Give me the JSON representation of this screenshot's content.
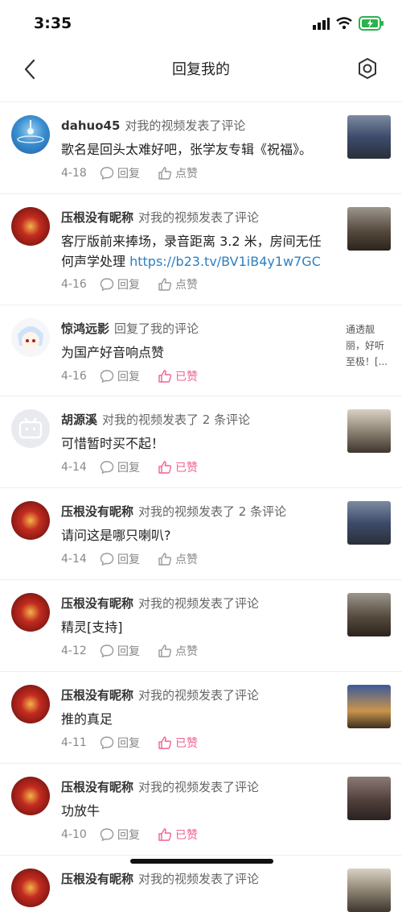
{
  "status": {
    "time": "3:35"
  },
  "nav": {
    "title": "回复我的"
  },
  "labels": {
    "reply": "回复",
    "like": "点赞",
    "liked": "已赞"
  },
  "items": [
    {
      "user": "dahuo45",
      "action": "对我的视频发表了评论",
      "comment": "歌名是回头太难好吧，张学友专辑《祝福》。",
      "link": "",
      "date": "4-18",
      "liked": false
    },
    {
      "user": "压根没有昵称",
      "action": "对我的视频发表了评论",
      "comment": "客厅版前来捧场，录音距离 3.2 米，房间无任何声学处理 ",
      "link": "https://b23.tv/BV1iB4y1w7GC",
      "date": "4-16",
      "liked": false
    },
    {
      "user": "惊鸿远影",
      "action": "回复了我的评论",
      "comment": "为国产好音响点赞",
      "link": "",
      "date": "4-16",
      "liked": true,
      "snippet": "通透靓丽，好听至极！[..."
    },
    {
      "user": "胡源溪",
      "action": "对我的视频发表了 2 条评论",
      "comment": "可惜暂时买不起！",
      "link": "",
      "date": "4-14",
      "liked": true
    },
    {
      "user": "压根没有昵称",
      "action": "对我的视频发表了 2 条评论",
      "comment": "请问这是哪只喇叭?",
      "link": "",
      "date": "4-14",
      "liked": false
    },
    {
      "user": "压根没有昵称",
      "action": "对我的视频发表了评论",
      "comment": "精灵[支持]",
      "link": "",
      "date": "4-12",
      "liked": false
    },
    {
      "user": "压根没有昵称",
      "action": "对我的视频发表了评论",
      "comment": "推的真足",
      "link": "",
      "date": "4-11",
      "liked": true
    },
    {
      "user": "压根没有昵称",
      "action": "对我的视频发表了评论",
      "comment": "功放牛",
      "link": "",
      "date": "4-10",
      "liked": true
    },
    {
      "user": "压根没有昵称",
      "action": "对我的视频发表了评论",
      "comment": "",
      "link": "",
      "date": "",
      "liked": false
    }
  ],
  "colors": {
    "accent": "#f06292",
    "link": "#2d7fc1"
  }
}
